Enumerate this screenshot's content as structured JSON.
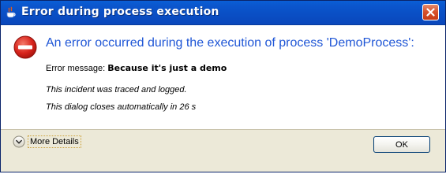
{
  "window": {
    "title": "Error during process execution",
    "title_icon": "java-app-icon",
    "close_icon": "close-icon"
  },
  "content": {
    "icon": "error-icon",
    "headline": "An error occurred during the execution of process 'DemoProcess':",
    "message_label": "Error message: ",
    "message_value": "Because it's just a demo",
    "trace_note": "This incident was traced and logged.",
    "auto_close_note": "This dialog closes automatically in 26 s"
  },
  "footer": {
    "more_details_icon": "chevron-down-icon",
    "more_details_label": "More Details",
    "ok_label": "OK"
  },
  "colors": {
    "titlebar": "#0a4ec4",
    "headline": "#1f56d6",
    "error_icon": "#d8241c",
    "footer_bg": "#ece9d8"
  }
}
